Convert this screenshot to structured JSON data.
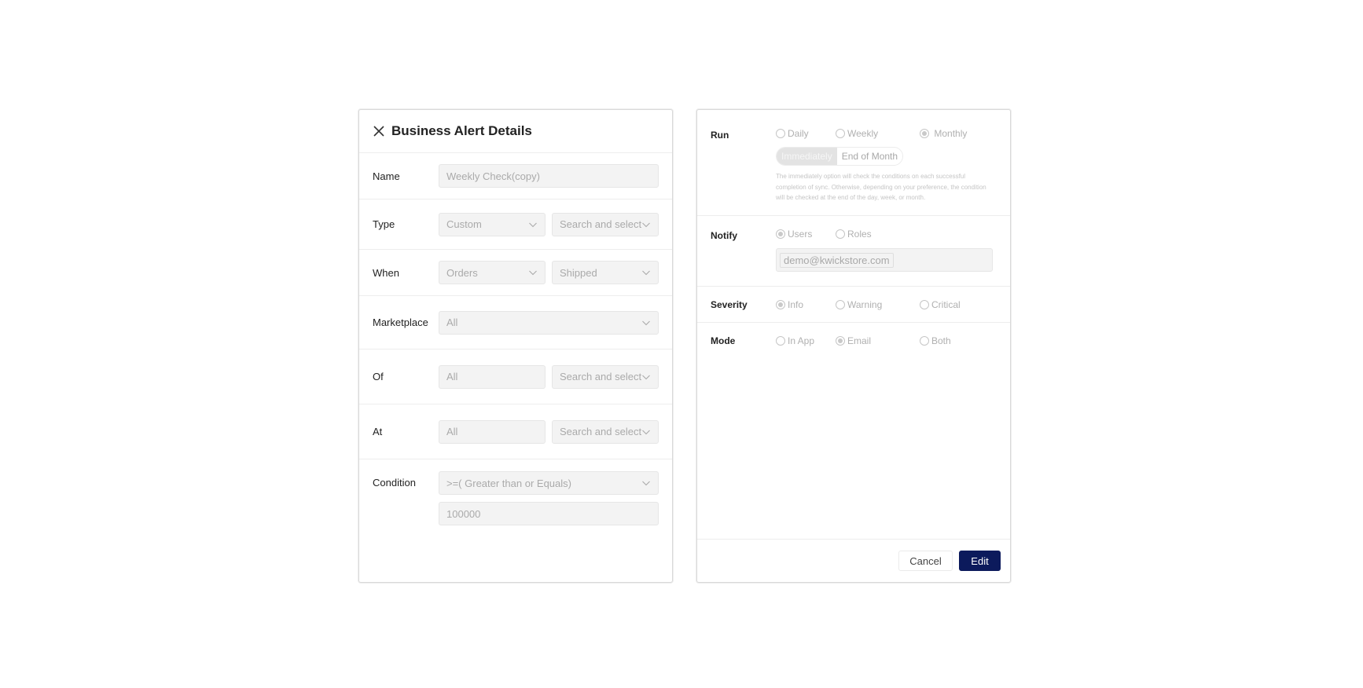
{
  "left_panel": {
    "title": "Business Alert Details",
    "close_icon": "close-icon",
    "rows": {
      "name": {
        "label": "Name",
        "value": "Weekly Check(copy)"
      },
      "type": {
        "label": "Type",
        "select1": "Custom",
        "select2_placeholder": "Search and select"
      },
      "when": {
        "label": "When",
        "select1": "Orders",
        "select2": "Shipped"
      },
      "marketplace": {
        "label": "Marketplace",
        "select": "All"
      },
      "of": {
        "label": "Of",
        "input": "All",
        "select_placeholder": "Search and select"
      },
      "at": {
        "label": "At",
        "input": "All",
        "select_placeholder": "Search and select"
      },
      "condition": {
        "label": "Condition",
        "operator": ">=( Greater than or Equals)",
        "value": "100000"
      }
    }
  },
  "right_panel": {
    "run": {
      "label": "Run",
      "options": [
        "Daily",
        "Weekly",
        "Monthly"
      ],
      "selected": "Monthly",
      "timing_options": [
        "Immediately",
        "End of Month"
      ],
      "timing_selected": "Immediately",
      "hint": "The immediately option will check the conditions on each successful completion of sync. Otherwise, depending on your preference, the condition will be checked at the end of the day, week, or month."
    },
    "notify": {
      "label": "Notify",
      "options": [
        "Users",
        "Roles"
      ],
      "selected": "Users",
      "recipients": [
        "demo@kwickstore.com"
      ]
    },
    "severity": {
      "label": "Severity",
      "options": [
        "Info",
        "Warning",
        "Critical"
      ],
      "selected": "Info"
    },
    "mode": {
      "label": "Mode",
      "options": [
        "In App",
        "Email",
        "Both"
      ],
      "selected": "Email"
    },
    "footer": {
      "cancel_label": "Cancel",
      "edit_label": "Edit"
    }
  },
  "colors": {
    "primary_button": "#0c1a5c",
    "disabled_field_bg": "#f3f3f3",
    "disabled_text": "#aaaaaa"
  }
}
